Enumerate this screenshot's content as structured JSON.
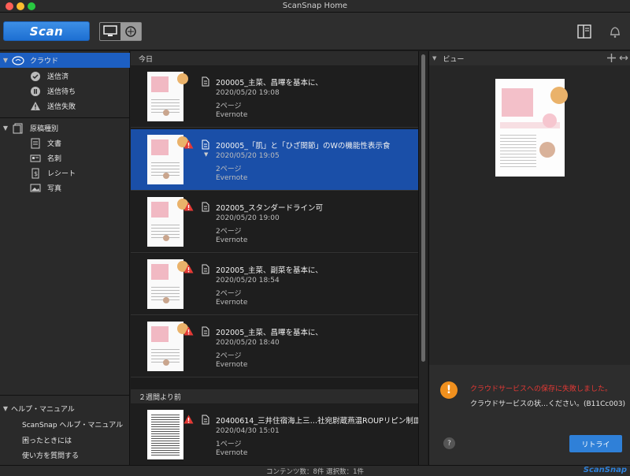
{
  "window": {
    "title": "ScanSnap Home"
  },
  "toolbar": {
    "scan_label": "Scan"
  },
  "sidebar": {
    "cloud": {
      "label": "クラウド",
      "items": [
        {
          "label": "送信済",
          "icon": "check-circle-icon"
        },
        {
          "label": "送信待ち",
          "icon": "pause-circle-icon"
        },
        {
          "label": "送信失敗",
          "icon": "warning-icon"
        }
      ]
    },
    "doctype": {
      "label": "原稿種別",
      "items": [
        {
          "label": "文書",
          "icon": "document-icon"
        },
        {
          "label": "名刺",
          "icon": "business-card-icon"
        },
        {
          "label": "レシート",
          "icon": "receipt-icon"
        },
        {
          "label": "写真",
          "icon": "photo-icon"
        }
      ]
    },
    "help": {
      "label": "ヘルプ・マニュアル",
      "items": [
        {
          "label": "ScanSnap ヘルプ・マニュアル"
        },
        {
          "label": "困ったときには"
        },
        {
          "label": "使い方を質問する"
        }
      ]
    }
  },
  "list": {
    "sections": [
      {
        "label": "今日"
      },
      {
        "label": "２週間より前"
      }
    ],
    "items": [
      {
        "title": "200005_主菜、昌嗶を基本に、",
        "date": "2020/05/20 19:08",
        "pages": "2ページ",
        "service": "Evernote",
        "warning": false,
        "selected": false
      },
      {
        "title": "200005_「肌」と「ひざ関節」のWの機能性表示食",
        "date": "2020/05/20 19:05",
        "pages": "2ページ",
        "service": "Evernote",
        "warning": true,
        "selected": true
      },
      {
        "title": "202005_スタンダードライン可",
        "date": "2020/05/20 19:00",
        "pages": "2ページ",
        "service": "Evernote",
        "warning": true,
        "selected": false
      },
      {
        "title": "202005_主菜、副菜を基本に、",
        "date": "2020/05/20 18:54",
        "pages": "2ページ",
        "service": "Evernote",
        "warning": true,
        "selected": false
      },
      {
        "title": "202005_主菜、昌嗶を基本に、",
        "date": "2020/05/20 18:40",
        "pages": "2ページ",
        "service": "Evernote",
        "warning": true,
        "selected": false
      },
      {
        "title": "20400614_三井住宿海上三…社宛尉蔵燕温ROUPリピン制皿",
        "date": "2020/04/30 15:01",
        "pages": "1ページ",
        "service": "Evernote",
        "warning": true,
        "selected": false
      }
    ]
  },
  "preview": {
    "label": "ビュー",
    "error_title": "クラウドサービスへの保存に失敗しました。",
    "error_detail": "クラウドサービスの状…ください。(B11Cc003)",
    "help_label": "?",
    "retry_label": "リトライ"
  },
  "status": {
    "text": "コンテンツ数：8件   選択数：1件",
    "logo": "ScanSnap"
  },
  "colors": {
    "accent": "#1d5fc2",
    "selected_row": "#1a4fa8",
    "error": "#e53935",
    "warning_orange": "#f0901e"
  }
}
